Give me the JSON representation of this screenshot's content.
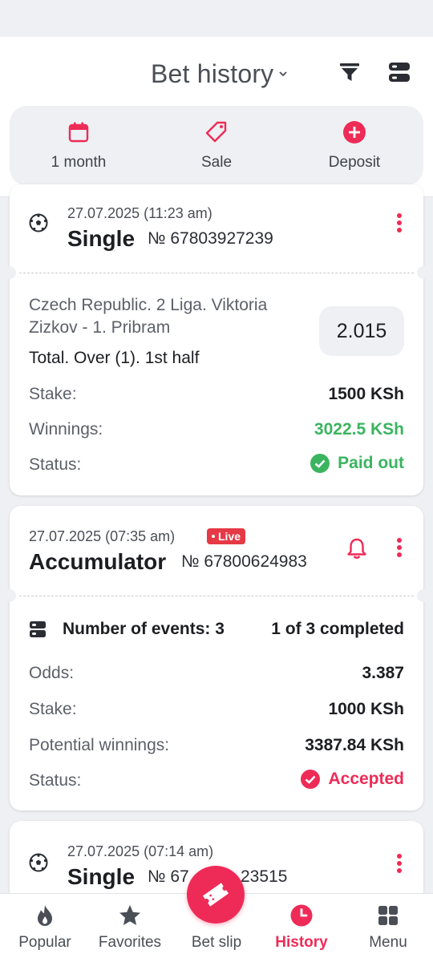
{
  "header": {
    "title": "Bet history",
    "quick_actions": [
      {
        "label": "1 month",
        "icon": "calendar-icon"
      },
      {
        "label": "Sale",
        "icon": "tag-icon"
      },
      {
        "label": "Deposit",
        "icon": "plus-circle-icon"
      }
    ]
  },
  "colors": {
    "accent": "#ee2b57",
    "success": "#3bb460",
    "live": "#e53945"
  },
  "bets": [
    {
      "date": "27.07.2025 (11:23 am)",
      "type": "Single",
      "number": "№ 67803927239",
      "event": "Czech Republic. 2 Liga. Viktoria Zizkov - 1. Pribram",
      "market": "Total. Over (1). 1st half",
      "odds": "2.015",
      "stake_label": "Stake:",
      "stake": "1500 KSh",
      "winnings_label": "Winnings:",
      "winnings": "3022.5 KSh",
      "status_label": "Status:",
      "status": "Paid out"
    },
    {
      "date": "27.07.2025 (07:35 am)",
      "live": "Live",
      "type": "Accumulator",
      "number": "№ 67800624983",
      "events_count": "Number of events: 3",
      "completed": "1 of 3 completed",
      "odds_label": "Odds:",
      "odds": "3.387",
      "stake_label": "Stake:",
      "stake": "1000 KSh",
      "potential_label": "Potential winnings:",
      "potential": "3387.84 KSh",
      "status_label": "Status:",
      "status": "Accepted"
    },
    {
      "date": "27.07.2025 (07:14 am)",
      "type": "Single",
      "number_left": "№ 67",
      "number_right": "23515"
    }
  ],
  "nav": [
    {
      "label": "Popular",
      "icon": "flame-icon"
    },
    {
      "label": "Favorites",
      "icon": "star-icon"
    },
    {
      "label": "Bet slip",
      "icon": "ticket-icon"
    },
    {
      "label": "History",
      "icon": "clock-icon",
      "active": true
    },
    {
      "label": "Menu",
      "icon": "grid-icon"
    }
  ]
}
